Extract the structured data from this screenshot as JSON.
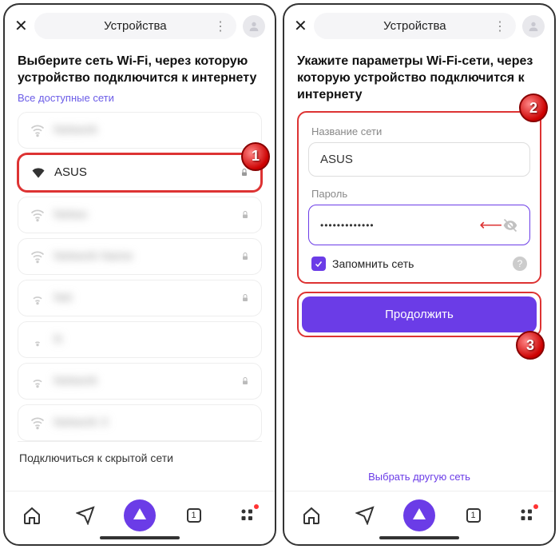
{
  "header": {
    "title": "Устройства"
  },
  "left": {
    "heading": "Выберите сеть Wi-Fi, через которую устройство подключится к интернету",
    "subhead": "Все доступные сети",
    "selected_network": "ASUS",
    "hidden_link": "Подключиться к скрытой сети",
    "badge": "1"
  },
  "right": {
    "heading": "Укажите параметры Wi-Fi-сети, через которую устройство подключится к интернету",
    "name_label": "Название сети",
    "name_value": "ASUS",
    "pwd_label": "Пароль",
    "pwd_value": "•••••••••••••",
    "remember": "Запомнить сеть",
    "continue": "Продолжить",
    "alt_link": "Выбрать другую сеть",
    "badge_form": "2",
    "badge_btn": "3"
  },
  "nav": {
    "tab_count": "1"
  }
}
